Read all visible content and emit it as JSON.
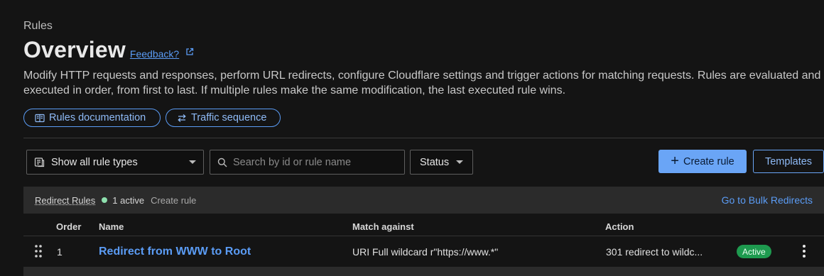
{
  "header": {
    "breadcrumb": "Rules",
    "title": "Overview",
    "feedback_link": "Feedback?",
    "description": "Modify HTTP requests and responses, perform URL redirects, configure Cloudflare settings and trigger actions for matching requests. Rules are evaluated and executed in order, from first to last. If multiple rules make the same modification, the last executed rule wins."
  },
  "links": {
    "docs": "Rules documentation",
    "traffic": "Traffic sequence"
  },
  "toolbar": {
    "type_filter_value": "Show all rule types",
    "search_placeholder": "Search by id or rule name",
    "status_label": "Status",
    "create_label": "Create rule",
    "templates_label": "Templates"
  },
  "group": {
    "name": "Redirect Rules",
    "active_text": "1 active",
    "create_link": "Create rule",
    "bulk_link": "Go to Bulk Redirects"
  },
  "table": {
    "columns": [
      "Order",
      "Name",
      "Match against",
      "Action"
    ],
    "rows": [
      {
        "order": "1",
        "name": "Redirect from WWW to Root",
        "match": "URI Full wildcard r\"https://www.*\"",
        "action": "301 redirect to wildc...",
        "status": "Active"
      }
    ]
  },
  "colors": {
    "background": "#141414",
    "accent": "#5b9cf5",
    "primary_button": "#6aa5f6",
    "active_badge": "#1e9a4f",
    "active_dot": "#8ee0ae"
  },
  "icons": [
    "external-link-icon",
    "book-icon",
    "swap-arrows-icon",
    "rule-types-icon",
    "search-icon",
    "plus-icon",
    "drag-handle-icon",
    "kebab-menu-icon"
  ]
}
